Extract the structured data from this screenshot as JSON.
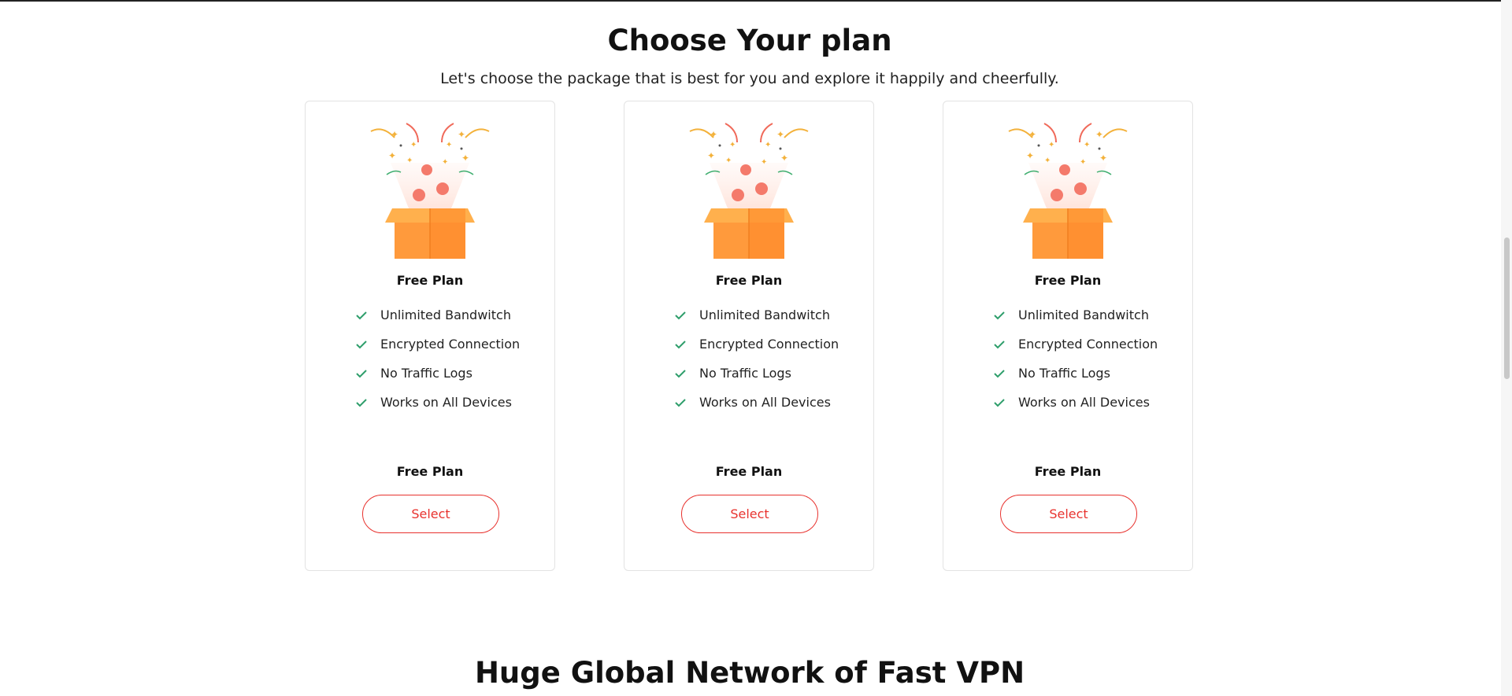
{
  "pricing": {
    "title": "Choose Your plan",
    "subtitle": "Let's choose the package that is best for you and explore it happily and cheerfully.",
    "plans": [
      {
        "name": "Free Plan",
        "features": [
          "Unlimited Bandwitch",
          "Encrypted Connection",
          "No Traffic Logs",
          "Works on All Devices"
        ],
        "price_label": "Free Plan",
        "button_label": "Select"
      },
      {
        "name": "Free Plan",
        "features": [
          "Unlimited Bandwitch",
          "Encrypted Connection",
          "No Traffic Logs",
          "Works on All Devices"
        ],
        "price_label": "Free Plan",
        "button_label": "Select"
      },
      {
        "name": "Free Plan",
        "features": [
          "Unlimited Bandwitch",
          "Encrypted Connection",
          "No Traffic Logs",
          "Works on All Devices"
        ],
        "price_label": "Free Plan",
        "button_label": "Select"
      }
    ]
  },
  "network": {
    "title": "Huge Global Network of Fast VPN"
  },
  "icons": {
    "feature": "check-icon",
    "illustration": "gift-box-confetti-illustration"
  },
  "colors": {
    "accent": "#e8322e",
    "check": "#2e9e6b",
    "box_orange": "#ff9a3c"
  }
}
